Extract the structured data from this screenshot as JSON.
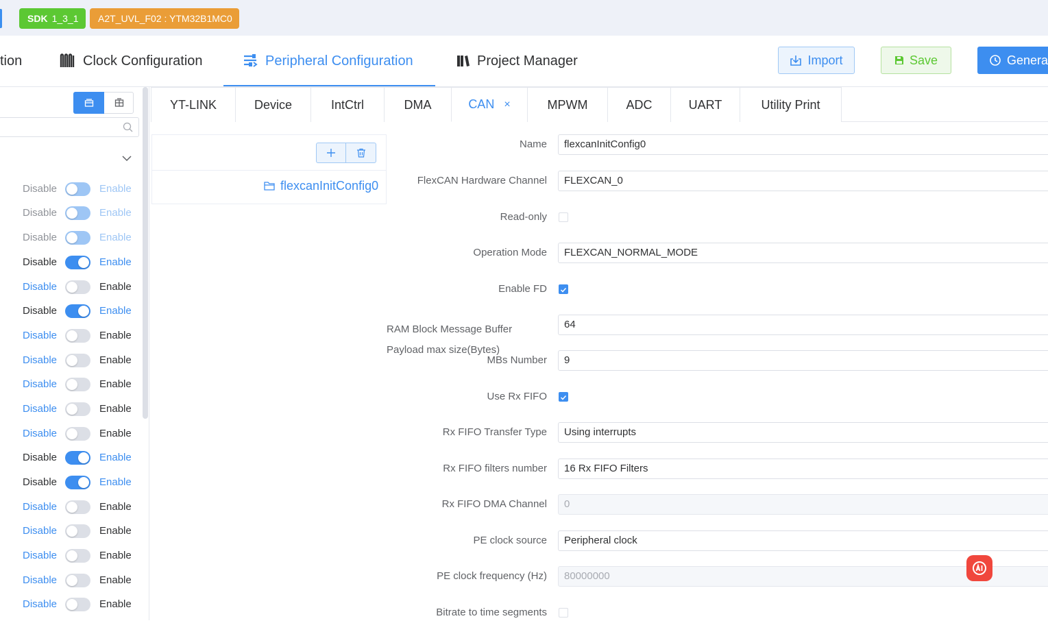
{
  "topbar": {
    "sdk_label": "SDK",
    "sdk_version": "1_3_1",
    "chip": "A2T_UVL_F02 : YTM32B1MC0"
  },
  "nav": {
    "items": [
      {
        "label": "tion"
      },
      {
        "label": "Clock Configuration"
      },
      {
        "label": "Peripheral Configuration"
      },
      {
        "label": "Project Manager"
      }
    ],
    "import_label": "Import",
    "save_label": "Save",
    "generate_label": "Genera"
  },
  "left": {
    "search_placeholder": "",
    "rows": [
      {
        "disable": "Disable",
        "enable": "Enable",
        "state": "dis"
      },
      {
        "disable": "Disable",
        "enable": "Enable",
        "state": "dis"
      },
      {
        "disable": "Disable",
        "enable": "Enable",
        "state": "dis"
      },
      {
        "disable": "Disable",
        "enable": "Enable",
        "state": "on"
      },
      {
        "disable": "Disable",
        "enable": "Enable",
        "state": "off"
      },
      {
        "disable": "Disable",
        "enable": "Enable",
        "state": "on"
      },
      {
        "disable": "Disable",
        "enable": "Enable",
        "state": "off"
      },
      {
        "disable": "Disable",
        "enable": "Enable",
        "state": "off"
      },
      {
        "disable": "Disable",
        "enable": "Enable",
        "state": "off"
      },
      {
        "disable": "Disable",
        "enable": "Enable",
        "state": "off"
      },
      {
        "disable": "Disable",
        "enable": "Enable",
        "state": "off"
      },
      {
        "disable": "Disable",
        "enable": "Enable",
        "state": "on"
      },
      {
        "disable": "Disable",
        "enable": "Enable",
        "state": "on"
      },
      {
        "disable": "Disable",
        "enable": "Enable",
        "state": "off"
      },
      {
        "disable": "Disable",
        "enable": "Enable",
        "state": "off"
      },
      {
        "disable": "Disable",
        "enable": "Enable",
        "state": "off"
      },
      {
        "disable": "Disable",
        "enable": "Enable",
        "state": "off"
      },
      {
        "disable": "Disable",
        "enable": "Enable",
        "state": "off"
      }
    ]
  },
  "tabs": [
    {
      "label": "YT-LINK"
    },
    {
      "label": "Device"
    },
    {
      "label": "IntCtrl"
    },
    {
      "label": "DMA"
    },
    {
      "label": "CAN",
      "close": "×"
    },
    {
      "label": "MPWM"
    },
    {
      "label": "ADC"
    },
    {
      "label": "UART"
    },
    {
      "label": "Utility Print"
    }
  ],
  "tree": {
    "node_label": "flexcanInitConfig0"
  },
  "form": {
    "name": {
      "label": "Name",
      "value": "flexcanInitConfig0"
    },
    "hw_channel": {
      "label": "FlexCAN Hardware Channel",
      "value": "FLEXCAN_0"
    },
    "read_only": {
      "label": "Read-only",
      "checked": false
    },
    "op_mode": {
      "label": "Operation Mode",
      "value": "FLEXCAN_NORMAL_MODE"
    },
    "enable_fd": {
      "label": "Enable FD",
      "checked": true
    },
    "ram_payload": {
      "label": "RAM Block Message Buffer Payload max size(Bytes)",
      "value": "64"
    },
    "mbs_number": {
      "label": "MBs Number",
      "value": "9"
    },
    "use_rx_fifo": {
      "label": "Use Rx FIFO",
      "checked": true
    },
    "rx_fifo_transfer": {
      "label": "Rx FIFO Transfer Type",
      "value": "Using interrupts"
    },
    "rx_fifo_filters": {
      "label": "Rx FIFO filters number",
      "value": "16 Rx FIFO Filters"
    },
    "rx_fifo_dma": {
      "label": "Rx FIFO DMA Channel",
      "value": "0"
    },
    "pe_clock_source": {
      "label": "PE clock source",
      "value": "Peripheral clock"
    },
    "pe_clock_freq": {
      "label": "PE clock frequency (Hz)",
      "value": "80000000"
    },
    "bitrate_segments": {
      "label": "Bitrate to time segments",
      "checked": false
    }
  },
  "colors": {
    "accent": "#3d8ef0",
    "sdk_tag": "#5cc833",
    "chip_tag": "#ea9d37",
    "ai_button": "#f0473d"
  },
  "icons": {
    "clock": "clock-config-icon",
    "peripheral": "peripheral-config-icon",
    "project": "project-manager-icon",
    "import": "import-icon",
    "save": "save-icon",
    "generate": "generate-icon",
    "ai": "ai-assistant-icon"
  }
}
